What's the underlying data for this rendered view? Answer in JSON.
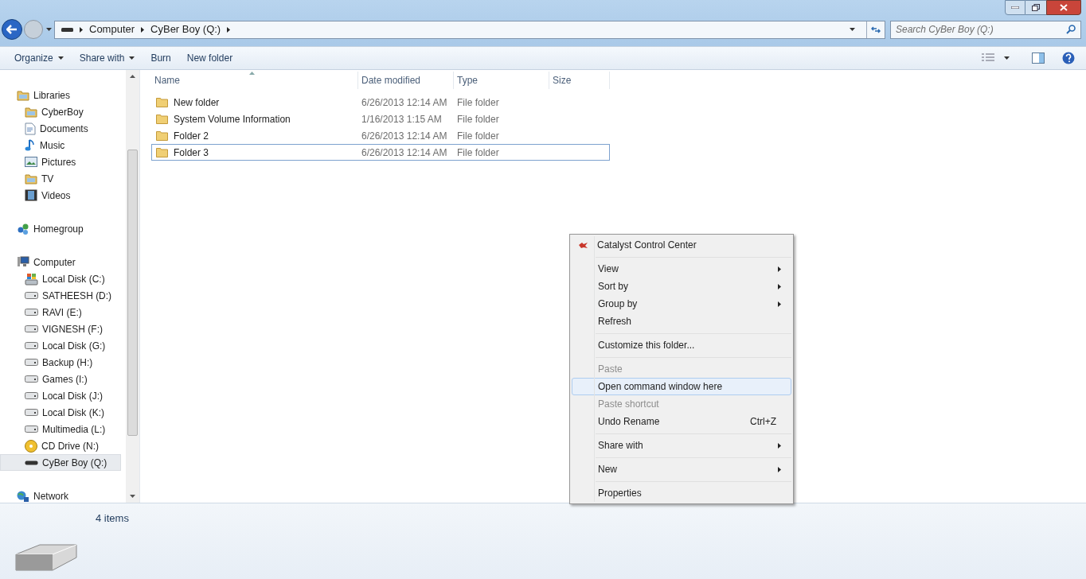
{
  "breadcrumb": [
    "Computer",
    "CyBer Boy (Q:)"
  ],
  "search": {
    "placeholder": "Search CyBer Boy (Q:)"
  },
  "toolbar": [
    "Organize",
    "Share with",
    "Burn",
    "New folder"
  ],
  "toolbar_dropdowns": [
    true,
    true,
    false,
    false
  ],
  "nav": [
    {
      "label": "Libraries",
      "kind": "library",
      "selected": false,
      "children": [
        {
          "label": "CyberBoy",
          "kind": "library",
          "selected": false
        },
        {
          "label": "Documents",
          "kind": "document",
          "selected": false
        },
        {
          "label": "Music",
          "kind": "music",
          "selected": false
        },
        {
          "label": "Pictures",
          "kind": "picture",
          "selected": false
        },
        {
          "label": "TV",
          "kind": "library",
          "selected": false
        },
        {
          "label": "Videos",
          "kind": "video",
          "selected": false
        }
      ]
    },
    {
      "label": "Homegroup",
      "kind": "homegroup",
      "selected": false
    },
    {
      "label": "Computer",
      "kind": "computer",
      "selected": false,
      "children": [
        {
          "label": "Local Disk (C:)",
          "kind": "system",
          "selected": false
        },
        {
          "label": "SATHEESH (D:)",
          "kind": "drive",
          "selected": false
        },
        {
          "label": "RAVI (E:)",
          "kind": "drive",
          "selected": false
        },
        {
          "label": "VIGNESH (F:)",
          "kind": "drive",
          "selected": false
        },
        {
          "label": "Local Disk (G:)",
          "kind": "drive",
          "selected": false
        },
        {
          "label": "Backup (H:)",
          "kind": "drive",
          "selected": false
        },
        {
          "label": "Games (I:)",
          "kind": "drive",
          "selected": false
        },
        {
          "label": "Local Disk (J:)",
          "kind": "drive",
          "selected": false
        },
        {
          "label": "Local Disk (K:)",
          "kind": "drive",
          "selected": false
        },
        {
          "label": "Multimedia (L:)",
          "kind": "drive",
          "selected": false
        },
        {
          "label": "CD Drive (N:)",
          "kind": "cd",
          "selected": false
        },
        {
          "label": "CyBer Boy (Q:)",
          "kind": "usb",
          "selected": true
        }
      ]
    },
    {
      "label": "Network",
      "kind": "network",
      "selected": false
    }
  ],
  "columns": [
    "Name",
    "Date modified",
    "Type",
    "Size"
  ],
  "rows": [
    {
      "name": "New folder",
      "date": "6/26/2013 12:14 AM",
      "type": "File folder",
      "selected": false
    },
    {
      "name": "System Volume Information",
      "date": "1/16/2013 1:15 AM",
      "type": "File folder",
      "selected": false
    },
    {
      "name": "Folder 2",
      "date": "6/26/2013 12:14 AM",
      "type": "File folder",
      "selected": false
    },
    {
      "name": "Folder 3",
      "date": "6/26/2013 12:14 AM",
      "type": "File folder",
      "selected": true
    }
  ],
  "context_menu": [
    {
      "kind": "app",
      "label": "Catalyst Control Center"
    },
    {
      "kind": "separator"
    },
    {
      "kind": "item",
      "label": "View",
      "submenu": true,
      "disabled": false,
      "selected": false
    },
    {
      "kind": "item",
      "label": "Sort by",
      "submenu": true,
      "disabled": false,
      "selected": false
    },
    {
      "kind": "item",
      "label": "Group by",
      "submenu": true,
      "disabled": false,
      "selected": false
    },
    {
      "kind": "item",
      "label": "Refresh",
      "submenu": false,
      "disabled": false,
      "selected": false
    },
    {
      "kind": "separator"
    },
    {
      "kind": "item",
      "label": "Customize this folder...",
      "submenu": false,
      "disabled": false,
      "selected": false
    },
    {
      "kind": "separator"
    },
    {
      "kind": "item",
      "label": "Paste",
      "submenu": false,
      "disabled": true,
      "selected": false
    },
    {
      "kind": "item",
      "label": "Open command window here",
      "submenu": false,
      "disabled": false,
      "selected": true
    },
    {
      "kind": "item",
      "label": "Paste shortcut",
      "submenu": false,
      "disabled": true,
      "selected": false
    },
    {
      "kind": "item",
      "label": "Undo Rename",
      "shortcut": "Ctrl+Z",
      "submenu": false,
      "disabled": false,
      "selected": false
    },
    {
      "kind": "separator"
    },
    {
      "kind": "item",
      "label": "Share with",
      "submenu": true,
      "disabled": false,
      "selected": false
    },
    {
      "kind": "separator"
    },
    {
      "kind": "item",
      "label": "New",
      "submenu": true,
      "disabled": false,
      "selected": false
    },
    {
      "kind": "separator"
    },
    {
      "kind": "item",
      "label": "Properties",
      "submenu": false,
      "disabled": false,
      "selected": false
    }
  ],
  "status": {
    "count": "4 items"
  }
}
